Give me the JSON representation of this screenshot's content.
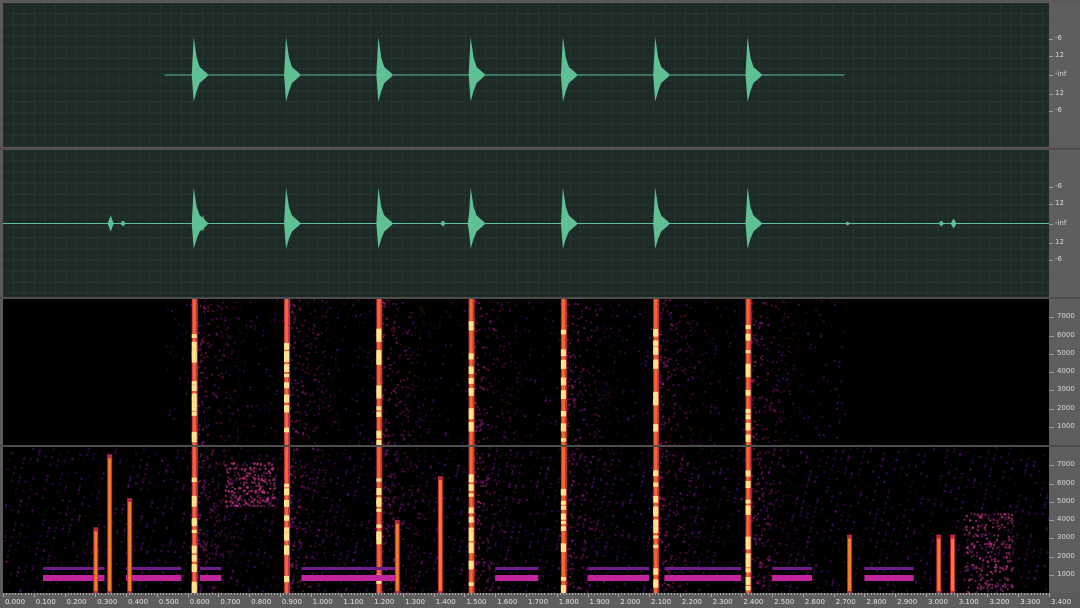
{
  "app": {
    "name": "audio spectrogram view"
  },
  "colors": {
    "wave_fill": "#5fbf95",
    "wave_bg": "#1d2a26",
    "spec_bg": "#000000",
    "scale_bg": "#5e5e5e"
  },
  "waveform_scale": {
    "labels": [
      "-6",
      "12",
      "-inf",
      "12",
      "-6"
    ]
  },
  "spectrogram_scale": {
    "labels": [
      "7000",
      "6000",
      "5000",
      "4000",
      "3000",
      "2000",
      "1000"
    ]
  },
  "time_ruler": {
    "labels": [
      "0.000",
      "0.100",
      "0.200",
      "0.300",
      "0.400",
      "0.500",
      "0.600",
      "0.700",
      "0.800",
      "0.900",
      "1.000",
      "1.100",
      "1.200",
      "1.300",
      "1.400",
      "1.500",
      "1.600",
      "1.700",
      "1.800",
      "1.900",
      "2.000",
      "2.100",
      "2.200",
      "2.300",
      "2.400",
      "2.500",
      "2.600",
      "2.700",
      "2.800",
      "2.900",
      "3.000",
      "3.100",
      "3.200",
      "3.300",
      "3.400"
    ]
  },
  "events": {
    "track1_clicks": [
      0.62,
      0.92,
      1.22,
      1.52,
      1.82,
      2.12,
      2.42
    ],
    "track2_clicks": [
      0.35,
      0.62,
      0.92,
      1.22,
      1.43,
      1.52,
      1.82,
      2.12,
      2.42,
      3.05,
      3.09
    ]
  }
}
